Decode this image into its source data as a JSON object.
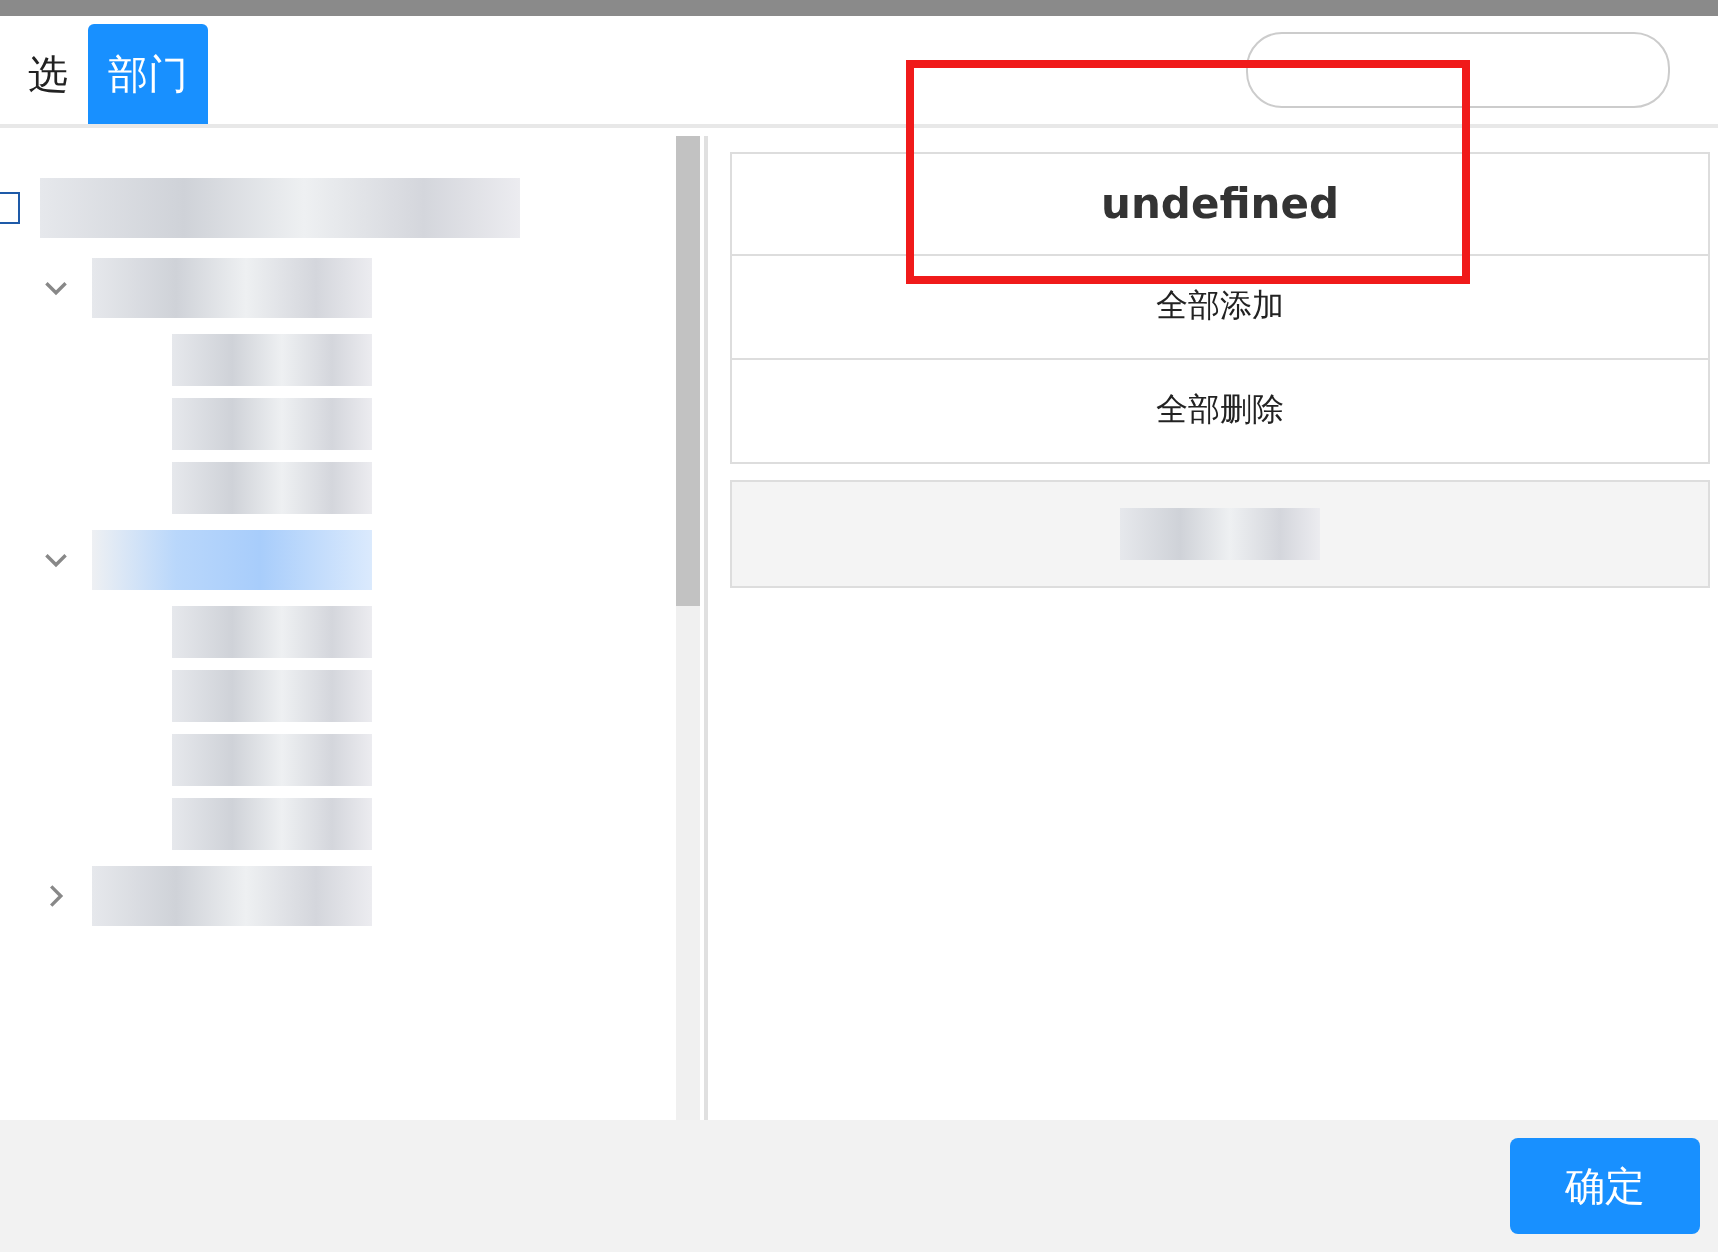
{
  "tabs": [
    {
      "label": "选",
      "selected": false
    },
    {
      "label": "部门",
      "selected": true
    }
  ],
  "tree": {
    "checked": false,
    "nodes": [
      {
        "expanded": true
      },
      {
        "expanded": true
      },
      {
        "expanded": false
      }
    ]
  },
  "actions": [
    {
      "label": "undefined",
      "kind": "heading"
    },
    {
      "label": "全部添加",
      "kind": "action"
    },
    {
      "label": "全部删除",
      "kind": "action"
    }
  ],
  "annotation": {
    "kind": "highlight"
  },
  "confirm": "确定"
}
